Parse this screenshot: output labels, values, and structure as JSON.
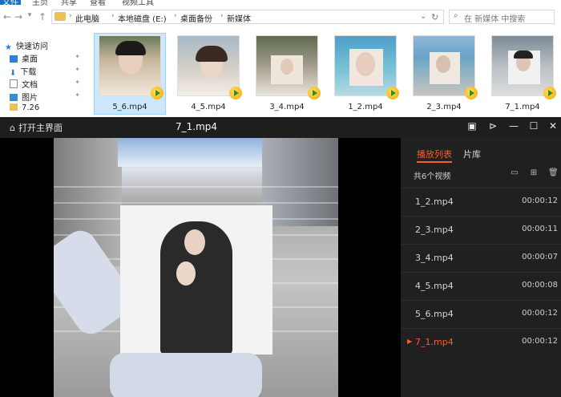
{
  "explorer": {
    "ribbon_tabs": [
      "文件",
      "主页",
      "共享",
      "查看",
      "视频工具"
    ],
    "nav_icons": [
      "back-arrow-icon",
      "forward-arrow-icon",
      "dropdown-icon",
      "up-arrow-icon"
    ],
    "breadcrumb": [
      "此电脑",
      "本地磁盘 (E:)",
      "桌面备份",
      "新媒体"
    ],
    "search_placeholder": "在 新媒体 中搜索",
    "nav_items": [
      {
        "label": "快速访问",
        "icon": "star-icon",
        "color": "#2b7cd3"
      },
      {
        "label": "桌面",
        "icon": "desktop-icon",
        "color": "#2f7fd6"
      },
      {
        "label": "下载",
        "icon": "download-icon",
        "color": "#2f7fd6"
      },
      {
        "label": "文档",
        "icon": "document-icon",
        "color": "#8a8a8a"
      },
      {
        "label": "图片",
        "icon": "picture-icon",
        "color": "#3b8ad9"
      },
      {
        "label": "7.26",
        "icon": "folder-icon",
        "color": "#e8c25a"
      }
    ],
    "files": [
      {
        "name": "5_6.mp4",
        "selected": true
      },
      {
        "name": "4_5.mp4",
        "selected": false
      },
      {
        "name": "3_4.mp4",
        "selected": false
      },
      {
        "name": "1_2.mp4",
        "selected": false
      },
      {
        "name": "2_3.mp4",
        "selected": false
      },
      {
        "name": "7_1.mp4",
        "selected": false
      }
    ]
  },
  "player": {
    "home_label": "打开主界面",
    "title": "7_1.mp4",
    "window_controls": [
      "screen-icon",
      "pin-icon",
      "minimize-icon",
      "maximize-icon",
      "close-icon"
    ],
    "tabs": {
      "playlist": "播放列表",
      "library": "片库"
    },
    "count_label": "共6个视频",
    "toolbar_icons": [
      "open-folder-icon",
      "add-icon",
      "delete-icon"
    ],
    "playlist": [
      {
        "name": "1_2.mp4",
        "duration": "00:00:12",
        "current": false
      },
      {
        "name": "2_3.mp4",
        "duration": "00:00:11",
        "current": false
      },
      {
        "name": "3_4.mp4",
        "duration": "00:00:07",
        "current": false
      },
      {
        "name": "4_5.mp4",
        "duration": "00:00:08",
        "current": false
      },
      {
        "name": "5_6.mp4",
        "duration": "00:00:12",
        "current": false
      },
      {
        "name": "7_1.mp4",
        "duration": "00:00:12",
        "current": true
      }
    ],
    "accent": "#ff5a2a"
  }
}
